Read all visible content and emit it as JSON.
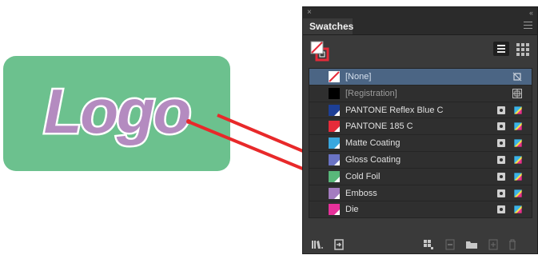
{
  "logo": {
    "text": "Logo",
    "card_color": "#6cc18e",
    "text_color": "#b48bc0"
  },
  "annotation": {
    "arrow_color": "#e8292a",
    "arrow_count": 2
  },
  "panel": {
    "tab": "Swatches",
    "close_glyph": "×",
    "collapse_glyph": "‹‹",
    "swatches": [
      {
        "name": "[None]",
        "color": "none",
        "selected": true,
        "dim": true,
        "spot": false,
        "icons": [
          "no-print-icon"
        ]
      },
      {
        "name": "[Registration]",
        "color": "#000000",
        "selected": false,
        "dim": true,
        "spot": false,
        "icons": [
          "registration-icon"
        ]
      },
      {
        "name": "PANTONE Reflex Blue C",
        "color": "#1d3f96",
        "selected": false,
        "dim": false,
        "spot": true,
        "icons": [
          "spot-icon",
          "cmyk-icon"
        ]
      },
      {
        "name": "PANTONE 185 C",
        "color": "#e62b3a",
        "selected": false,
        "dim": false,
        "spot": true,
        "icons": [
          "spot-icon",
          "cmyk-icon"
        ]
      },
      {
        "name": "Matte Coating",
        "color": "#39a7de",
        "selected": false,
        "dim": false,
        "spot": true,
        "icons": [
          "spot-icon",
          "cmyk-icon"
        ]
      },
      {
        "name": "Gloss Coating",
        "color": "#6a73c4",
        "selected": false,
        "dim": false,
        "spot": true,
        "icons": [
          "spot-icon",
          "cmyk-icon"
        ]
      },
      {
        "name": "Cold Foil",
        "color": "#59b77a",
        "selected": false,
        "dim": false,
        "spot": true,
        "icons": [
          "spot-icon",
          "cmyk-icon"
        ]
      },
      {
        "name": "Emboss",
        "color": "#a47cc0",
        "selected": false,
        "dim": false,
        "spot": true,
        "icons": [
          "spot-icon",
          "cmyk-icon"
        ]
      },
      {
        "name": "Die",
        "color": "#e6319a",
        "selected": false,
        "dim": false,
        "spot": true,
        "icons": [
          "spot-icon",
          "cmyk-icon"
        ]
      }
    ],
    "bottom_icons": [
      "swatch-libraries-icon",
      "place-swatches-icon",
      "new-color-group-icon",
      "swatch-options-icon",
      "new-folder-icon",
      "new-swatch-icon",
      "delete-swatch-icon"
    ]
  }
}
